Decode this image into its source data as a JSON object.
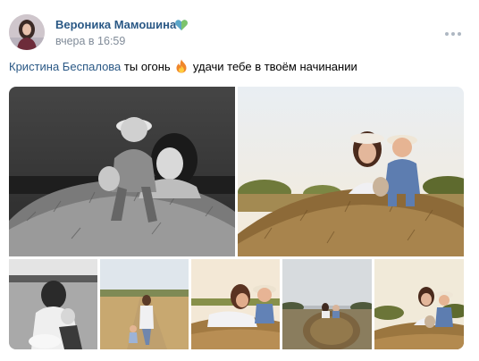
{
  "post": {
    "author": "Вероника Мамошина",
    "author_badge_icon": "heart-emoji-icon",
    "time": "вчера в 16:59",
    "more_icon": "more-dots-icon",
    "text": {
      "mention": "Кристина Беспалова",
      "part1": " ты огонь",
      "emoji_icon": "fire-emoji-icon",
      "part2": " удачи тебе в твоём начинании"
    },
    "photo_count": 7
  },
  "colors": {
    "link": "#2a5885",
    "meta": "#818c99",
    "more_dots": "#aeb7c2"
  }
}
